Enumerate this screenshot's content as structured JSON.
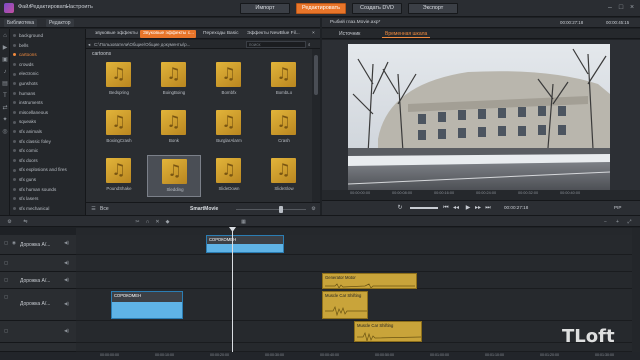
{
  "menu": {
    "items": [
      "Файл",
      "Редактировать",
      "Настроить"
    ]
  },
  "modes": [
    {
      "label": "Импорт",
      "active": false
    },
    {
      "label": "Редактировать",
      "active": true
    },
    {
      "label": "Создать DVD",
      "active": false
    },
    {
      "label": "Экспорт",
      "active": false
    }
  ],
  "library": {
    "tabs": [
      "Библиотека",
      "Редактор"
    ],
    "categories": [
      "background",
      "bells",
      "cartoons",
      "crowds",
      "electronic",
      "gunshots",
      "humans",
      "instruments",
      "miscellaneous",
      "squeaks",
      "sfx animals",
      "sfx classic foley",
      "sfx comic",
      "sfx doors",
      "sfx explosions and fires",
      "sfx guns",
      "sfx human sounds",
      "sfx lasers",
      "sfx mechanical"
    ],
    "selected_category": "cartoons",
    "filter_tabs": [
      "звуковые эффекты",
      "Звуковые эффекты с...",
      "Переходы Basic",
      "Эффекты NewBlue Fil..."
    ],
    "folder": "cartoons",
    "path": "C:\\Пользователи\\Общие\\Общие документы\\p...",
    "search_placeholder": "поиск",
    "count_text": "18 элементов, 1 выбрано",
    "items": [
      "Bedspring",
      "BoingBoing",
      "Bombfx",
      "BombLo",
      "BoxingCrash",
      "Bonk",
      "BurglarAlarm",
      "Crash",
      "PoundShake",
      "Sledding",
      "SlideDown",
      "SlideSlow"
    ],
    "selected_item": "Sledding",
    "footer": {
      "smart_movie": "SmartMovie",
      "dropdown": "Все"
    }
  },
  "player": {
    "file_title": "Рыбий глаз.Movie.axp*",
    "timecode_left": "00:00:27:18",
    "timecode_right": "00:00:45:15",
    "tabs": [
      "Источник",
      "Временная шкала"
    ],
    "active_tab": "Временная шкала",
    "ruler": [
      "00:00:00:00",
      "00:00:08:00",
      "00:00:16:00",
      "00:00:24:00",
      "00:00:32:00",
      "00:00:40:00"
    ],
    "transport_time": "00:00:27:18",
    "speed_label": "PIP"
  },
  "timeline": {
    "tracks": [
      {
        "label": "Дорожка А/...",
        "clips": [
          {
            "title": "СОРОКОМЕН",
            "color": "blue"
          }
        ]
      },
      {
        "label": "",
        "clips": []
      },
      {
        "label": "Дорожка А/...",
        "clips": []
      },
      {
        "label": "",
        "clips": [
          {
            "title": "Generator Motor",
            "color": "gold"
          }
        ]
      },
      {
        "label": "Дорожка А/...",
        "clips": [
          {
            "title": "СОРОКОМЕН",
            "color": "blue"
          },
          {
            "title": "Muscle Car Shifting",
            "color": "gold"
          }
        ]
      },
      {
        "label": "",
        "clips": [
          {
            "title": "Muscle Car Shifting",
            "color": "gold"
          }
        ]
      },
      {
        "label": "",
        "clips": []
      }
    ],
    "ruler": [
      "00:00:00:00",
      "00:00:10:00",
      "00:00:20:00",
      "00:00:30:00",
      "00:00:40:00",
      "00:00:50:00",
      "00:01:00:00",
      "00:01:10:00",
      "00:01:20:00",
      "00:01:30:00"
    ]
  },
  "colors": {
    "accent": "#e8752a",
    "clip_blue": "#5fb3e6",
    "clip_gold": "#c9a43a",
    "bg": "#1e2125"
  },
  "watermark": "TLoft"
}
